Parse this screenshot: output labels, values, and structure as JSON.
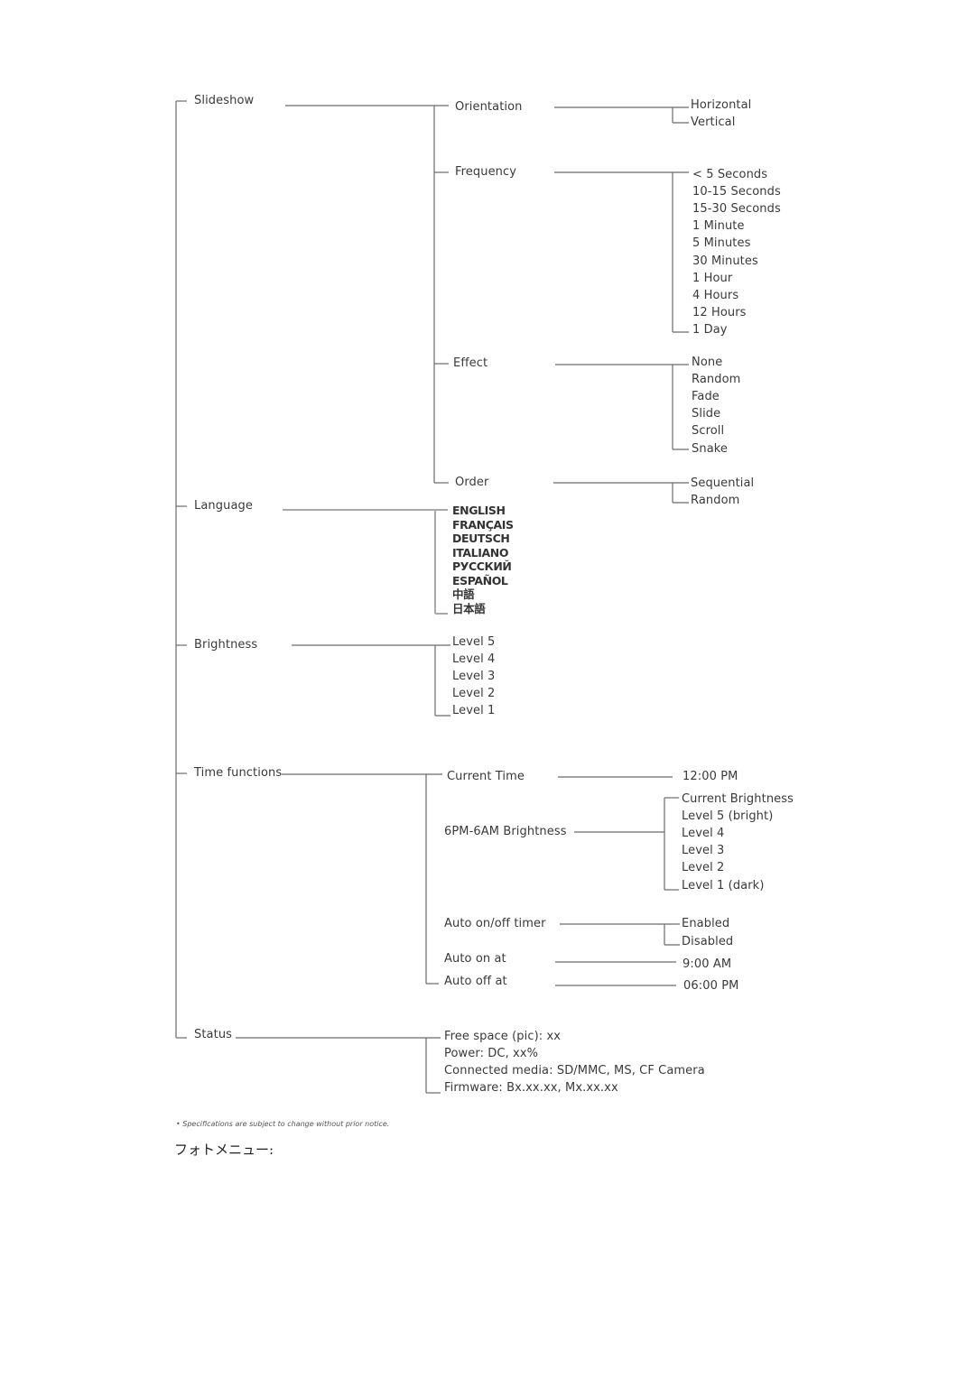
{
  "tree": {
    "slideshow": {
      "label": "Slideshow",
      "orientation": {
        "label": "Orientation",
        "options": [
          "Horizontal",
          "Vertical"
        ]
      },
      "frequency": {
        "label": "Frequency",
        "options": [
          "< 5 Seconds",
          "10-15 Seconds",
          "15-30 Seconds",
          "1 Minute",
          "5 Minutes",
          "30 Minutes",
          "1 Hour",
          "4 Hours",
          "12 Hours",
          "1 Day"
        ]
      },
      "effect": {
        "label": "Effect",
        "options": [
          "None",
          "Random",
          "Fade",
          "Slide",
          "Scroll",
          "Snake"
        ]
      },
      "order": {
        "label": "Order",
        "options": [
          "Sequential",
          "Random"
        ]
      }
    },
    "language": {
      "label": "Language",
      "options": [
        "ENGLISH",
        "FRANÇAIS",
        "DEUTSCH",
        "ITALIANO",
        "РУССКИЙ",
        "ESPAÑOL",
        "中語",
        "日本語"
      ]
    },
    "brightness": {
      "label": "Brightness",
      "options": [
        "Level 5",
        "Level 4",
        "Level 3",
        "Level 2",
        "Level 1"
      ]
    },
    "time_functions": {
      "label": "Time functions",
      "current_time": {
        "label": "Current Time",
        "value": "12:00 PM"
      },
      "night_brightness": {
        "label": "6PM-6AM Brightness",
        "options": [
          "Current Brightness",
          "Level 5 (bright)",
          "Level 4",
          "Level 3",
          "Level 2",
          "Level 1 (dark)"
        ]
      },
      "auto_timer": {
        "label": "Auto on/off timer",
        "options": [
          "Enabled",
          "Disabled"
        ]
      },
      "auto_on": {
        "label": "Auto on at",
        "value": "9:00 AM"
      },
      "auto_off": {
        "label": "Auto off at",
        "value": "06:00 PM"
      }
    },
    "status": {
      "label": "Status",
      "items": [
        "Free space (pic): xx",
        "Power: DC, xx%",
        "Connected media: SD/MMC, MS, CF Camera",
        "Firmware: Bx.xx.xx, Mx.xx.xx"
      ]
    }
  },
  "footnote": "• Specifications are subject to change without prior notice.",
  "caption": "フォトメニュー:"
}
